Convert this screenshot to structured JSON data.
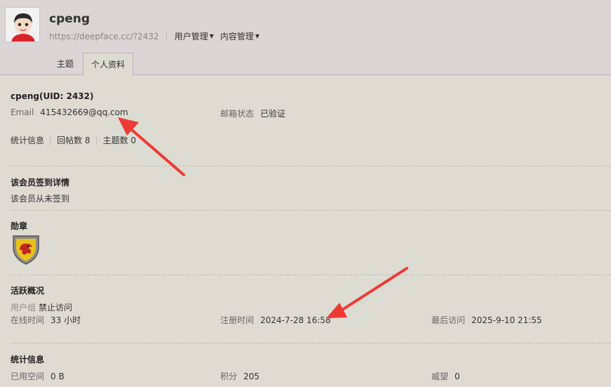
{
  "header": {
    "username": "cpeng",
    "url": "https://deepface.cc/?2432",
    "menus": [
      "用户管理",
      "内容管理"
    ],
    "tabs": [
      "主题",
      "个人资料"
    ],
    "active_tab": "个人资料"
  },
  "profile": {
    "name_uid": "cpeng(UID: 2432)",
    "email_label": "Email",
    "email_value": "415432669@qq.com",
    "email_status_label": "邮箱状态",
    "email_status_value": "已验证",
    "stats_label": "统计信息",
    "replies": "回帖数 8",
    "threads": "主题数 0"
  },
  "checkin": {
    "title": "该会员签到详情",
    "text": "该会员从未签到"
  },
  "medal": {
    "title": "勋章",
    "icon": "dragon-shield-medal-icon"
  },
  "activity": {
    "title": "活跃概况",
    "group_label": "用户组",
    "group_value": "禁止访问",
    "online_label": "在线时间",
    "online_value": "33 小时",
    "reg_label": "注册时间",
    "reg_value": "2024-7-28 16:58",
    "last_label": "最后访问",
    "last_value": "2025-9-10 21:55"
  },
  "stats": {
    "title": "统计信息",
    "space_label": "已用空间",
    "space_value": "0 B",
    "points_label": "积分",
    "points_value": "205",
    "prestige_label": "威望",
    "prestige_value": "0"
  },
  "colors": {
    "annotation_arrow": "#ee3a33",
    "header_bg": "#d9d6d5",
    "content_bg": "#dcdcd3"
  }
}
